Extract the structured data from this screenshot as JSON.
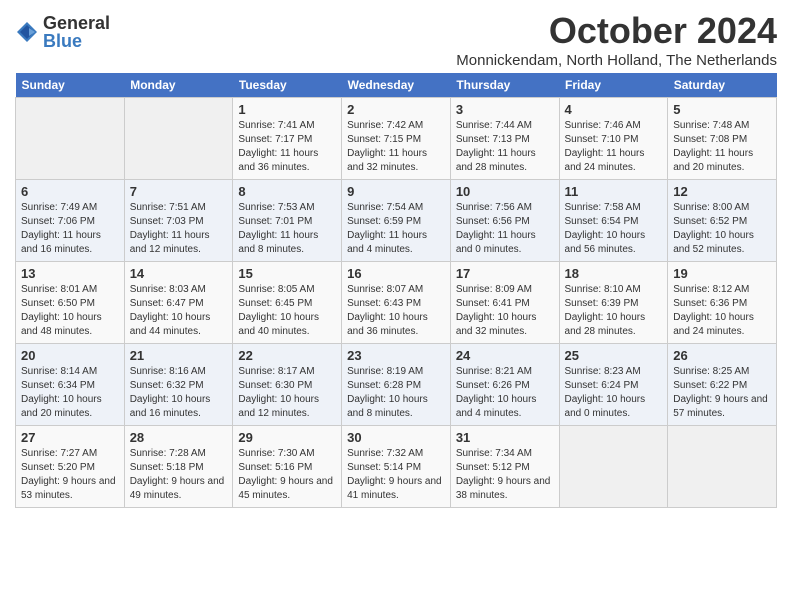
{
  "logo": {
    "general": "General",
    "blue": "Blue"
  },
  "title": "October 2024",
  "location": "Monnickendam, North Holland, The Netherlands",
  "weekdays": [
    "Sunday",
    "Monday",
    "Tuesday",
    "Wednesday",
    "Thursday",
    "Friday",
    "Saturday"
  ],
  "weeks": [
    [
      {
        "day": "",
        "info": ""
      },
      {
        "day": "",
        "info": ""
      },
      {
        "day": "1",
        "info": "Sunrise: 7:41 AM\nSunset: 7:17 PM\nDaylight: 11 hours and 36 minutes."
      },
      {
        "day": "2",
        "info": "Sunrise: 7:42 AM\nSunset: 7:15 PM\nDaylight: 11 hours and 32 minutes."
      },
      {
        "day": "3",
        "info": "Sunrise: 7:44 AM\nSunset: 7:13 PM\nDaylight: 11 hours and 28 minutes."
      },
      {
        "day": "4",
        "info": "Sunrise: 7:46 AM\nSunset: 7:10 PM\nDaylight: 11 hours and 24 minutes."
      },
      {
        "day": "5",
        "info": "Sunrise: 7:48 AM\nSunset: 7:08 PM\nDaylight: 11 hours and 20 minutes."
      }
    ],
    [
      {
        "day": "6",
        "info": "Sunrise: 7:49 AM\nSunset: 7:06 PM\nDaylight: 11 hours and 16 minutes."
      },
      {
        "day": "7",
        "info": "Sunrise: 7:51 AM\nSunset: 7:03 PM\nDaylight: 11 hours and 12 minutes."
      },
      {
        "day": "8",
        "info": "Sunrise: 7:53 AM\nSunset: 7:01 PM\nDaylight: 11 hours and 8 minutes."
      },
      {
        "day": "9",
        "info": "Sunrise: 7:54 AM\nSunset: 6:59 PM\nDaylight: 11 hours and 4 minutes."
      },
      {
        "day": "10",
        "info": "Sunrise: 7:56 AM\nSunset: 6:56 PM\nDaylight: 11 hours and 0 minutes."
      },
      {
        "day": "11",
        "info": "Sunrise: 7:58 AM\nSunset: 6:54 PM\nDaylight: 10 hours and 56 minutes."
      },
      {
        "day": "12",
        "info": "Sunrise: 8:00 AM\nSunset: 6:52 PM\nDaylight: 10 hours and 52 minutes."
      }
    ],
    [
      {
        "day": "13",
        "info": "Sunrise: 8:01 AM\nSunset: 6:50 PM\nDaylight: 10 hours and 48 minutes."
      },
      {
        "day": "14",
        "info": "Sunrise: 8:03 AM\nSunset: 6:47 PM\nDaylight: 10 hours and 44 minutes."
      },
      {
        "day": "15",
        "info": "Sunrise: 8:05 AM\nSunset: 6:45 PM\nDaylight: 10 hours and 40 minutes."
      },
      {
        "day": "16",
        "info": "Sunrise: 8:07 AM\nSunset: 6:43 PM\nDaylight: 10 hours and 36 minutes."
      },
      {
        "day": "17",
        "info": "Sunrise: 8:09 AM\nSunset: 6:41 PM\nDaylight: 10 hours and 32 minutes."
      },
      {
        "day": "18",
        "info": "Sunrise: 8:10 AM\nSunset: 6:39 PM\nDaylight: 10 hours and 28 minutes."
      },
      {
        "day": "19",
        "info": "Sunrise: 8:12 AM\nSunset: 6:36 PM\nDaylight: 10 hours and 24 minutes."
      }
    ],
    [
      {
        "day": "20",
        "info": "Sunrise: 8:14 AM\nSunset: 6:34 PM\nDaylight: 10 hours and 20 minutes."
      },
      {
        "day": "21",
        "info": "Sunrise: 8:16 AM\nSunset: 6:32 PM\nDaylight: 10 hours and 16 minutes."
      },
      {
        "day": "22",
        "info": "Sunrise: 8:17 AM\nSunset: 6:30 PM\nDaylight: 10 hours and 12 minutes."
      },
      {
        "day": "23",
        "info": "Sunrise: 8:19 AM\nSunset: 6:28 PM\nDaylight: 10 hours and 8 minutes."
      },
      {
        "day": "24",
        "info": "Sunrise: 8:21 AM\nSunset: 6:26 PM\nDaylight: 10 hours and 4 minutes."
      },
      {
        "day": "25",
        "info": "Sunrise: 8:23 AM\nSunset: 6:24 PM\nDaylight: 10 hours and 0 minutes."
      },
      {
        "day": "26",
        "info": "Sunrise: 8:25 AM\nSunset: 6:22 PM\nDaylight: 9 hours and 57 minutes."
      }
    ],
    [
      {
        "day": "27",
        "info": "Sunrise: 7:27 AM\nSunset: 5:20 PM\nDaylight: 9 hours and 53 minutes."
      },
      {
        "day": "28",
        "info": "Sunrise: 7:28 AM\nSunset: 5:18 PM\nDaylight: 9 hours and 49 minutes."
      },
      {
        "day": "29",
        "info": "Sunrise: 7:30 AM\nSunset: 5:16 PM\nDaylight: 9 hours and 45 minutes."
      },
      {
        "day": "30",
        "info": "Sunrise: 7:32 AM\nSunset: 5:14 PM\nDaylight: 9 hours and 41 minutes."
      },
      {
        "day": "31",
        "info": "Sunrise: 7:34 AM\nSunset: 5:12 PM\nDaylight: 9 hours and 38 minutes."
      },
      {
        "day": "",
        "info": ""
      },
      {
        "day": "",
        "info": ""
      }
    ]
  ]
}
